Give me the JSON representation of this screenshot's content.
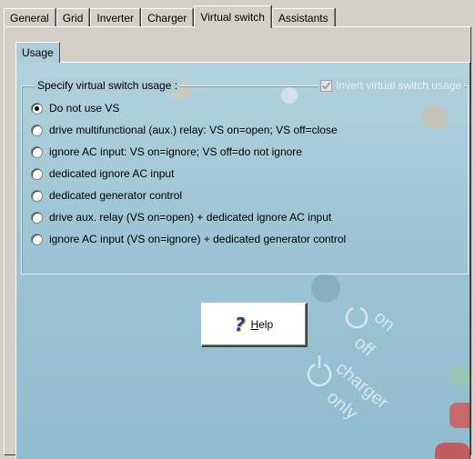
{
  "tabs": [
    {
      "label": "General",
      "active": false
    },
    {
      "label": "Grid",
      "active": false
    },
    {
      "label": "Inverter",
      "active": false
    },
    {
      "label": "Charger",
      "active": false
    },
    {
      "label": "Virtual switch",
      "active": true
    },
    {
      "label": "Assistants",
      "active": false
    }
  ],
  "inner_tab": {
    "label": "Usage"
  },
  "group": {
    "title": "Specify virtual switch usage :",
    "invert_label": "Invert virtual switch usage",
    "invert_checked": true,
    "options": [
      {
        "label": "Do not use VS",
        "checked": true
      },
      {
        "label": "drive multifunctional (aux.) relay: VS on=open; VS off=close",
        "checked": false
      },
      {
        "label": "ignore AC input: VS on=ignore;  VS off=do not ignore",
        "checked": false
      },
      {
        "label": "dedicated ignore AC input",
        "checked": false
      },
      {
        "label": "dedicated generator control",
        "checked": false
      },
      {
        "label": "drive aux. relay (VS on=open) + dedicated ignore AC input",
        "checked": false
      },
      {
        "label": "ignore AC input (VS on=ignore) + dedicated generator control",
        "checked": false
      }
    ]
  },
  "help_button": {
    "icon": "question-mark-icon",
    "label_accel": "H",
    "label_rest": "elp"
  },
  "decor": {
    "on": "on",
    "off": "off",
    "charger": "charger",
    "only": "only"
  },
  "colors": {
    "panel_bg": "#aecdd9",
    "window_bg": "#d4d0c8",
    "help_icon": "#1a3c9c"
  }
}
